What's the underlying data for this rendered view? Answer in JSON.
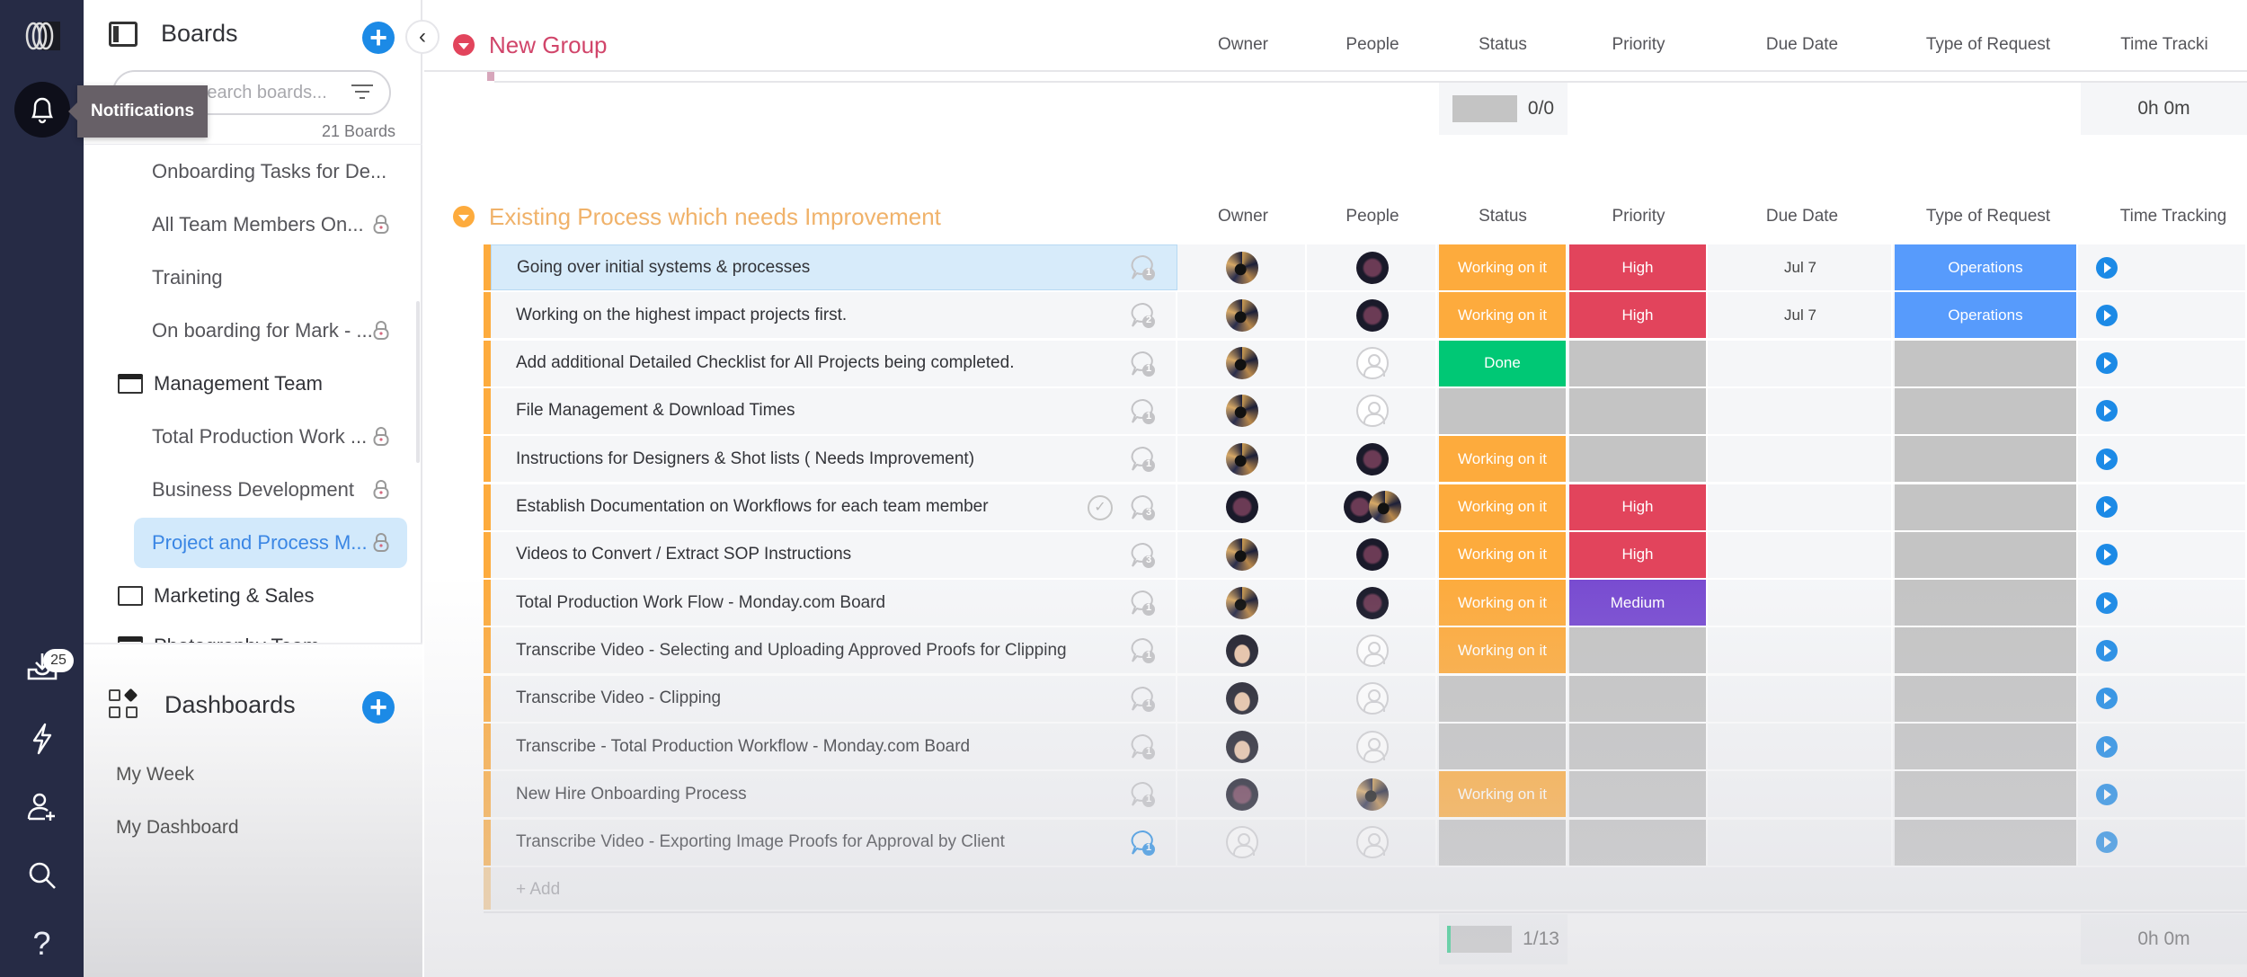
{
  "rail": {
    "logo": "monday-logo",
    "notifications_tooltip": "Notifications",
    "inbox_badge": "25",
    "help_label": "?"
  },
  "sidebar": {
    "title": "Boards",
    "search_placeholder": "Search boards...",
    "board_count": "21 Boards",
    "items": [
      {
        "label": "Onboarding Tasks for De...",
        "type": "board",
        "locked": false
      },
      {
        "label": "All Team Members On...",
        "type": "board",
        "locked": true
      },
      {
        "label": "Training",
        "type": "board",
        "locked": false
      },
      {
        "label": "On boarding for Mark - ...",
        "type": "board",
        "locked": true
      },
      {
        "label": "Management Team",
        "type": "folder-open"
      },
      {
        "label": "Total Production Work ...",
        "type": "board",
        "locked": true
      },
      {
        "label": "Business Development",
        "type": "board",
        "locked": true
      },
      {
        "label": "Project and Process M...",
        "type": "board",
        "locked": true,
        "active": true
      },
      {
        "label": "Marketing & Sales",
        "type": "folder"
      },
      {
        "label": "Photography Team",
        "type": "folder-open"
      }
    ],
    "dashboards": {
      "title": "Dashboards",
      "items": [
        "My Week",
        "My Dashboard"
      ]
    }
  },
  "columns": [
    "Owner",
    "People",
    "Status",
    "Priority",
    "Due Date",
    "Type of Request",
    "Time Tracking"
  ],
  "groups": [
    {
      "title": "New Group",
      "color": "#e2445c",
      "time_tracking_header": "Time Tracki",
      "summary": {
        "status_count": "0/0",
        "time_total": "0h 0m"
      },
      "rows": []
    },
    {
      "title": "Existing Process which needs Improvement",
      "color": "#fdab3d",
      "time_tracking_header": "Time Tracking",
      "summary": {
        "status_count": "1/13",
        "time_total": "0h 0m"
      },
      "add_label": "+ Add",
      "rows": [
        {
          "name": "Going over initial systems & processes",
          "updates": "1",
          "owner": "a1",
          "people": [
            "a2"
          ],
          "status": "Working on it",
          "priority": "High",
          "due": "Jul 7",
          "type": "Operations",
          "selected": true
        },
        {
          "name": "Working on the highest impact projects first.",
          "updates": "2",
          "owner": "a1",
          "people": [
            "a2"
          ],
          "status": "Working on it",
          "priority": "High",
          "due": "Jul 7",
          "type": "Operations"
        },
        {
          "name": "Add additional Detailed Checklist for All Projects being completed.",
          "updates": "1",
          "owner": "a1",
          "people": [],
          "status": "Done",
          "priority": "",
          "due": "",
          "type": ""
        },
        {
          "name": "File Management & Download Times",
          "updates": "1",
          "owner": "a1",
          "people": [],
          "status": "",
          "priority": "",
          "due": "",
          "type": ""
        },
        {
          "name": "Instructions for Designers & Shot lists ( Needs Improvement)",
          "updates": "1",
          "owner": "a1",
          "people": [
            "a2"
          ],
          "status": "Working on it",
          "priority": "",
          "due": "",
          "type": ""
        },
        {
          "name": "Establish Documentation on Workflows for each team member",
          "updates": "3",
          "checked": true,
          "owner": "a2",
          "people": [
            "a2",
            "a1"
          ],
          "status": "Working on it",
          "priority": "High",
          "due": "",
          "type": ""
        },
        {
          "name": "Videos to Convert / Extract SOP Instructions",
          "updates": "3",
          "owner": "a1",
          "people": [
            "a2"
          ],
          "status": "Working on it",
          "priority": "High",
          "due": "",
          "type": ""
        },
        {
          "name": "Total Production Work Flow - Monday.com Board",
          "updates": "1",
          "owner": "a1",
          "people": [
            "a2"
          ],
          "status": "Working on it",
          "priority": "Medium",
          "due": "",
          "type": ""
        },
        {
          "name": "Transcribe Video - Selecting and Uploading Approved Proofs for Clipping",
          "updates": "1",
          "owner": "a3",
          "people": [],
          "status": "Working on it",
          "priority": "",
          "due": "",
          "type": ""
        },
        {
          "name": "Transcribe Video - Clipping",
          "updates": "1",
          "owner": "a3",
          "people": [],
          "status": "",
          "priority": "",
          "due": "",
          "type": ""
        },
        {
          "name": "Transcribe - Total Production Workflow - Monday.com Board",
          "updates": "1",
          "owner": "a3",
          "people": [],
          "status": "",
          "priority": "",
          "due": "",
          "type": ""
        },
        {
          "name": "New Hire Onboarding Process",
          "updates": "1",
          "owner": "a2",
          "people": [
            "a1"
          ],
          "status": "Working on it",
          "priority": "",
          "due": "",
          "type": ""
        },
        {
          "name": "Transcribe Video - Exporting Image Proofs for Approval by Client",
          "updates": "1",
          "updates_unread": true,
          "owner": "",
          "people": [],
          "status": "",
          "priority": "",
          "due": "",
          "type": ""
        }
      ]
    }
  ],
  "colors": {
    "status": {
      "Working on it": "#fdab3d",
      "Done": "#00c875",
      "": "#c4c4c4"
    },
    "priority": {
      "High": "#e2445c",
      "Medium": "#784bd1",
      "": "#c4c4c4"
    },
    "type": {
      "Operations": "#579bfc",
      "": "#c4c4c4"
    },
    "accent": "#1c8ae6",
    "rail": "#262b45"
  }
}
